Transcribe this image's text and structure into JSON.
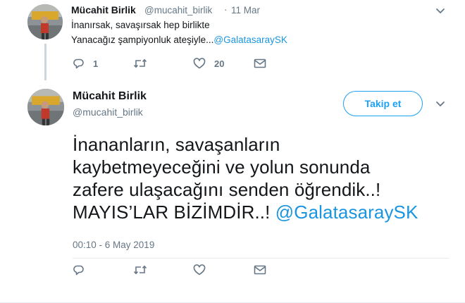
{
  "thread_parent": {
    "display_name": "Mücahit Birlik",
    "handle": "@mucahit_birlik",
    "separator": "·",
    "date": "11 Mar",
    "text_line1": "İnanırsak, savaşırsak hep birlikte",
    "text_line2_prefix": "Yanacağız şampiyonluk ateşiyle...",
    "text_line2_mention": "@GalatasaraySK",
    "actions": {
      "reply_count": "1",
      "retweet_count": "",
      "like_count": "20"
    },
    "icons": [
      "reply-icon",
      "retweet-icon",
      "like-icon",
      "message-icon",
      "chevron-down-icon"
    ]
  },
  "main_tweet": {
    "display_name": "Mücahit Birlik",
    "handle": "@mucahit_birlik",
    "follow_label": "Takip et",
    "text_lines": [
      "İnananların, savaşanların",
      "kaybetmeyeceğini ve yolun sonunda",
      "zafere ulaşacağını senden öğrendik..!",
      "MAYIS’LAR BİZİMDİR..! "
    ],
    "mention": "@GalatasaraySK",
    "timestamp": "00:10 - 6 May 2019",
    "icons": [
      "reply-icon",
      "retweet-icon",
      "like-icon",
      "message-icon",
      "chevron-down-icon"
    ]
  },
  "colors": {
    "link": "#1b95e0",
    "follow_accent": "#1da1f2",
    "secondary_text": "#657786",
    "primary_text": "#14171a"
  }
}
